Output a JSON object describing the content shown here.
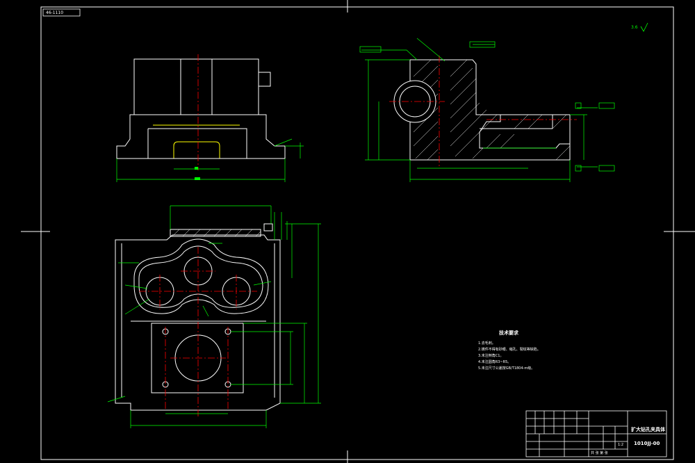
{
  "drawing": {
    "top_left_tag": "46-1110",
    "roughness_mark": "3.6",
    "technical_requirements": {
      "title": "技术要求",
      "lines": [
        "1.去毛刺。",
        "2.铸件不得有砂眼、缩孔、裂纹等缺陷。",
        "3.未注倒角C1。",
        "4.未注圆角R3~R5。",
        "5.未注尺寸公差按GB/T1804-m级。"
      ]
    },
    "title_block": {
      "part_name": "扩大钻孔夹具体",
      "drawing_number": "1010JJ-00",
      "scale": "1:2",
      "sheet_info": "共 张 第 张"
    },
    "colors": {
      "background": "#000000",
      "outline": "#ffffff",
      "dimension": "#00ff00",
      "centerline": "#ff0000",
      "object": "#ffff00"
    }
  }
}
